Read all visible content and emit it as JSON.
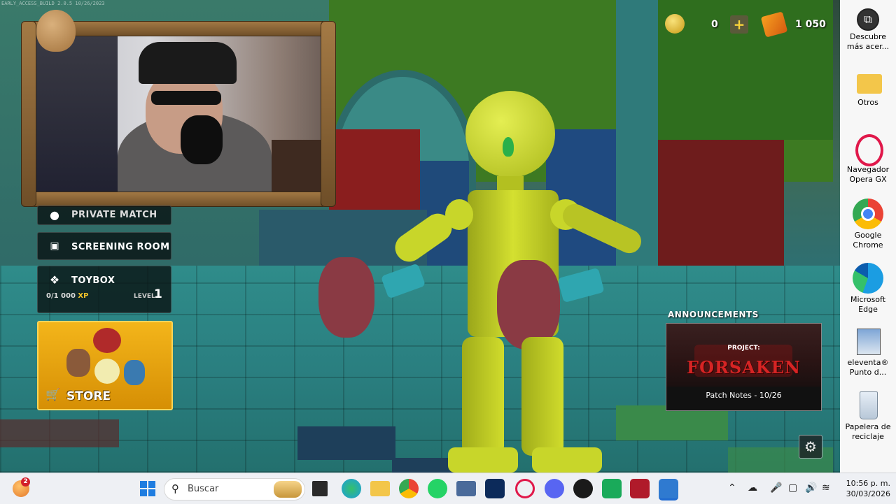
{
  "overlay": {
    "build_text": "EARLY_ACCESS_BUILD 2.0.5 10/26/2023"
  },
  "currency": {
    "coins": "0",
    "gems": "1 050"
  },
  "menu": {
    "private_match": "PRIVATE MATCH",
    "screening_room": "SCREENING ROOM",
    "toybox": {
      "label": "TOYBOX",
      "xp_value": "0/1 000",
      "xp_unit": "XP",
      "level_label": "LEVEL",
      "level_value": "1"
    },
    "store": "STORE"
  },
  "announcements": {
    "title": "ANNOUNCEMENTS",
    "card": {
      "kicker": "PROJECT:",
      "headline": "FORSAKEN",
      "caption": "Patch Notes - 10/26"
    }
  },
  "desktop_icons": [
    {
      "label_l1": "Descubre",
      "label_l2": "más acer..."
    },
    {
      "label_l1": "Otros",
      "label_l2": ""
    },
    {
      "label_l1": "Navegador",
      "label_l2": "Opera GX"
    },
    {
      "label_l1": "Google",
      "label_l2": "Chrome"
    },
    {
      "label_l1": "Microsoft",
      "label_l2": "Edge"
    },
    {
      "label_l1": "eleventa®",
      "label_l2": "Punto d..."
    },
    {
      "label_l1": "Papelera de",
      "label_l2": "reciclaje"
    }
  ],
  "taskbar": {
    "search_placeholder": "Buscar",
    "notification_count": "2",
    "time": "10:56 p. m.",
    "date": "30/03/2026"
  },
  "colors": {
    "robot": "#c8d62a",
    "store_bg": "#f3b51a",
    "taskbar_bg": "#eef0f4"
  }
}
